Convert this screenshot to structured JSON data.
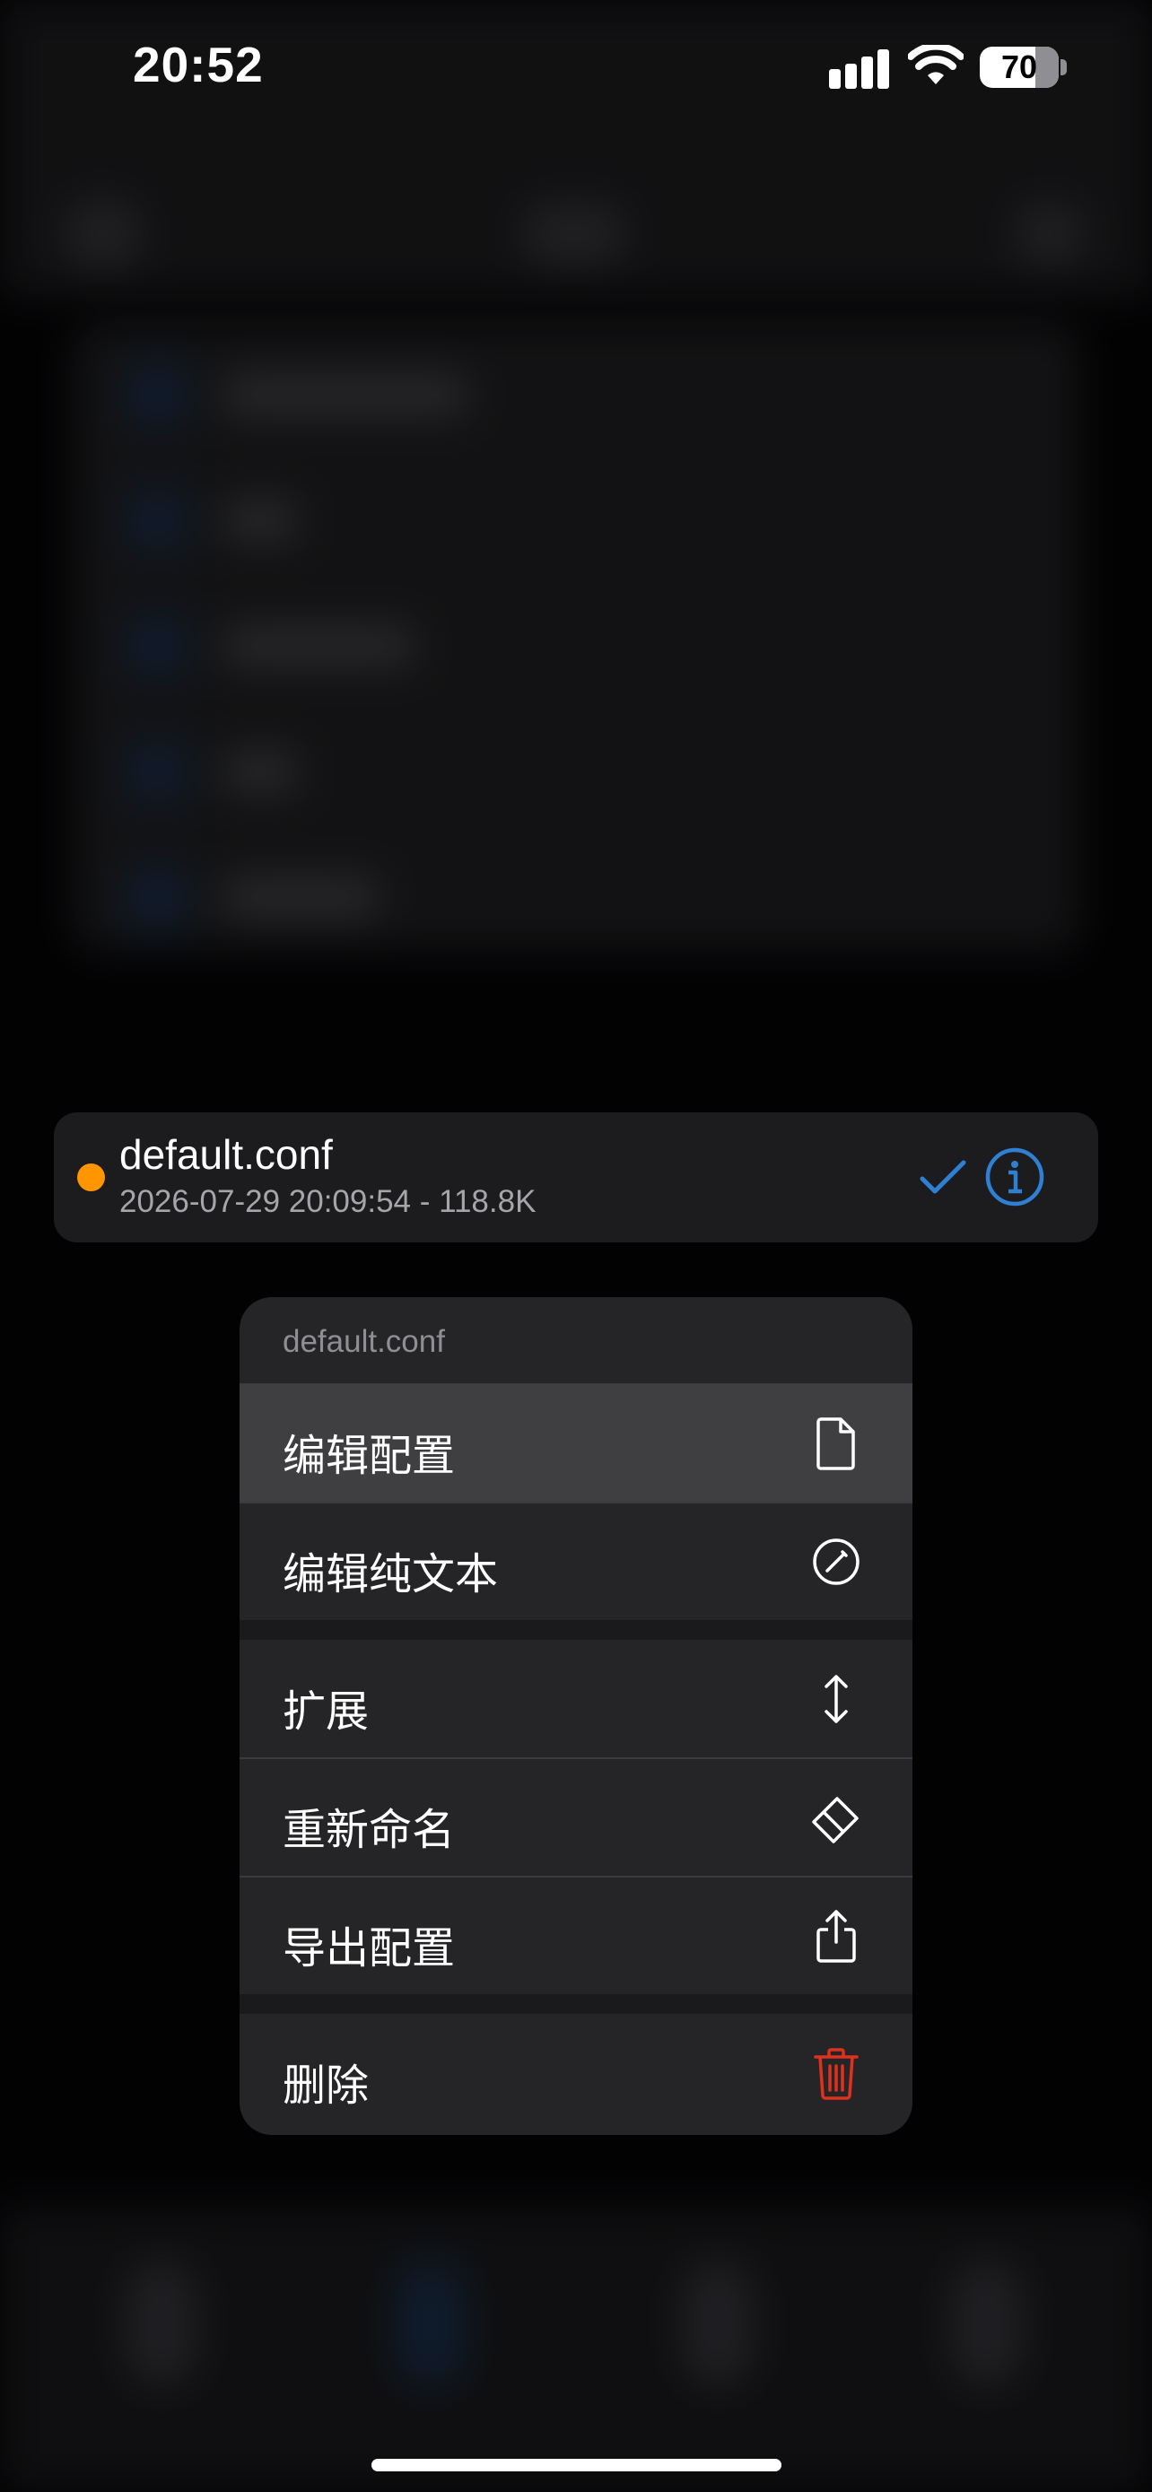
{
  "status_bar": {
    "time": "20:52",
    "battery": "70"
  },
  "config": {
    "name": "default.conf",
    "meta": "2026-07-29 20:09:54 - 118.8K",
    "status_color": "#ff9500",
    "accent": "#2f7fd3"
  },
  "menu": {
    "title": "default.conf",
    "items": [
      {
        "label": "编辑配置",
        "icon": "document-icon",
        "highlighted": true
      },
      {
        "label": "编辑纯文本",
        "icon": "slash-circle-icon"
      },
      {
        "label": "扩展",
        "icon": "up-down-arrows-icon"
      },
      {
        "label": "重新命名",
        "icon": "eraser-icon"
      },
      {
        "label": "导出配置",
        "icon": "share-icon"
      },
      {
        "label": "删除",
        "icon": "trash-icon",
        "destructive": true
      }
    ],
    "destructive_color": "#e0301e"
  }
}
